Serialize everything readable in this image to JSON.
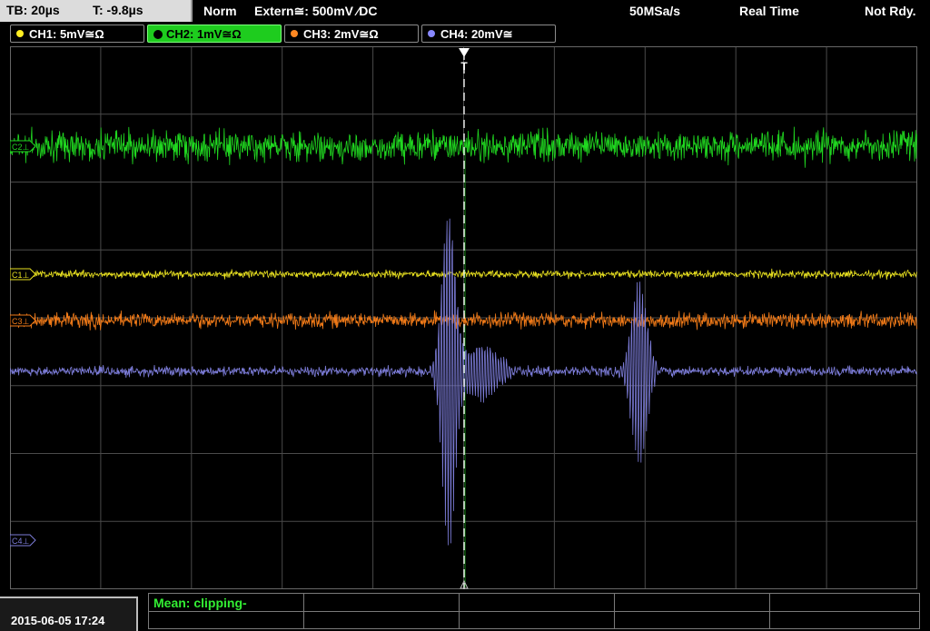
{
  "topbar": {
    "timebase": "TB: 20µs",
    "trigger_time": "T: -9.8µs",
    "trigger_mode": "Norm",
    "trigger_source": "Extern≅: 500mV ⁄DC",
    "sample_rate": "50MSa/s",
    "acquisition": "Real Time",
    "state": "Not Rdy."
  },
  "channels": [
    {
      "label": "CH1: 5mV≅Ω",
      "color": "#ffee22",
      "active": false
    },
    {
      "label": "CH2: 1mV≅Ω",
      "color": "#22ee22",
      "active": true
    },
    {
      "label": "CH3: 2mV≅Ω",
      "color": "#ff8822",
      "active": false
    },
    {
      "label": "CH4: 20mV≅",
      "color": "#8888ff",
      "active": false
    }
  ],
  "markers": {
    "c2": "C2⊥",
    "c1": "C1⊥",
    "c3": "C3⊥",
    "c4": "C4⊥",
    "trigger": "T"
  },
  "colors": {
    "ch1": "#e8e020",
    "ch2": "#20d820",
    "ch3": "#f07a18",
    "ch4": "#7c7cd8",
    "grid": "#4a4a4a"
  },
  "bottom": {
    "datetime": "2015-06-05 17:24",
    "measurement": "Mean: clipping-"
  }
}
